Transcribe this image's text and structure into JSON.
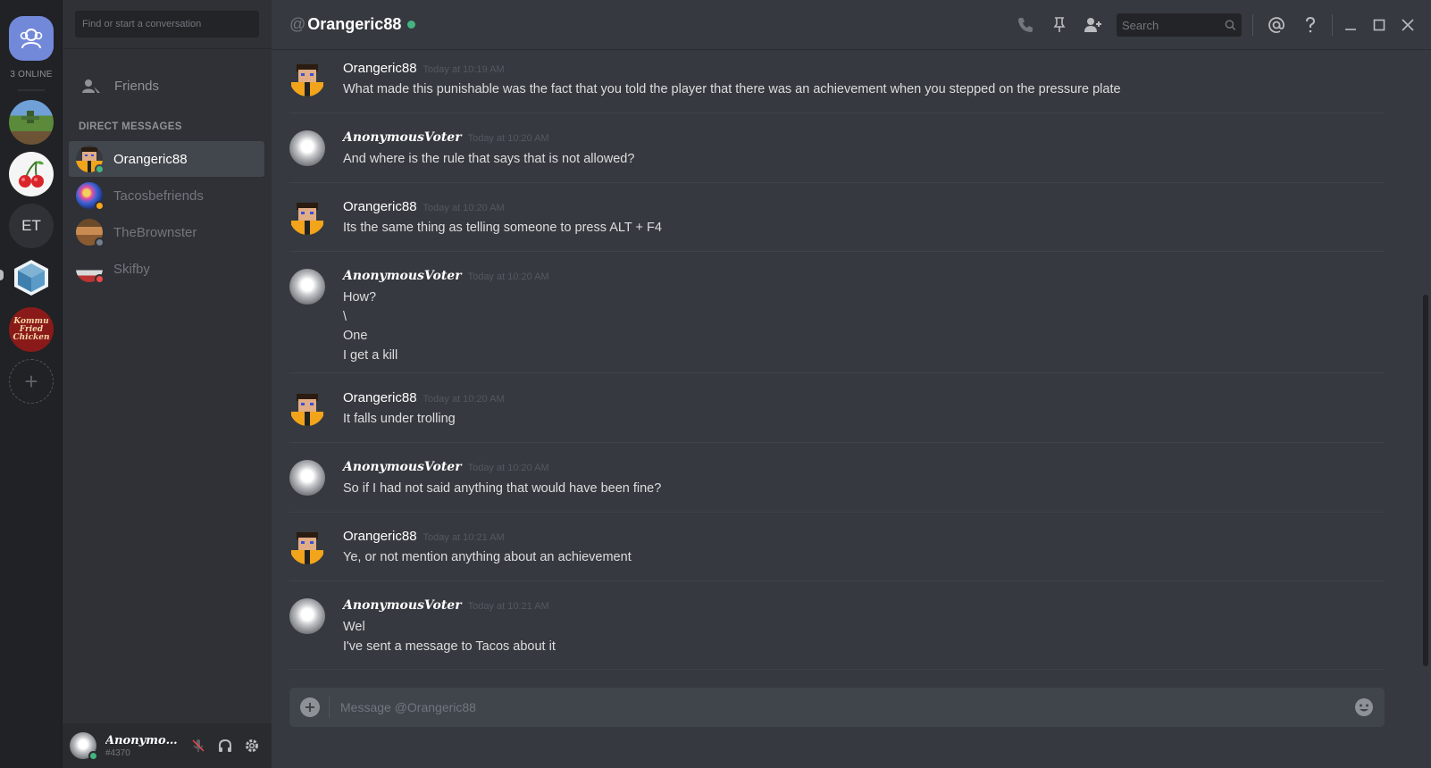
{
  "servers": {
    "online_count": "3 ONLINE",
    "et_label": "ET",
    "kfc_label_line1": "Kommu",
    "kfc_label_line2": "Fried",
    "kfc_label_line3": "Chicken",
    "add_label": "+"
  },
  "sidebar": {
    "search_placeholder": "Find or start a conversation",
    "friends_label": "Friends",
    "dm_header": "DIRECT MESSAGES",
    "dms": [
      {
        "name": "Orangeric88",
        "status_color": "#43b581"
      },
      {
        "name": "Tacosbefriends",
        "status_color": "#faa61a"
      },
      {
        "name": "TheBrownster",
        "status_color": "#747f8d"
      },
      {
        "name": "Skifby",
        "status_color": "#f04747"
      }
    ]
  },
  "user_panel": {
    "name": "Anonymou...",
    "tag": "#4370"
  },
  "header": {
    "at": "@",
    "channel": "Orangeric88",
    "search_placeholder": "Search"
  },
  "messages": [
    {
      "author": "Orangeric88",
      "time": "Today at 10:19 AM",
      "lines": [
        "What made this punishable was the fact that you told the player that there was an achievement when you stepped on the pressure plate"
      ]
    },
    {
      "author": "AnonymousVoter",
      "time": "Today at 10:20 AM",
      "lines": [
        "And where is the rule that says that is not allowed?"
      ]
    },
    {
      "author": "Orangeric88",
      "time": "Today at 10:20 AM",
      "lines": [
        "Its the same thing as telling someone to press ALT + F4"
      ]
    },
    {
      "author": "AnonymousVoter",
      "time": "Today at 10:20 AM",
      "lines": [
        "How?",
        "\\",
        "One",
        "I get a kill"
      ]
    },
    {
      "author": "Orangeric88",
      "time": "Today at 10:20 AM",
      "lines": [
        "It falls under trolling"
      ]
    },
    {
      "author": "AnonymousVoter",
      "time": "Today at 10:20 AM",
      "lines": [
        "So if I had not said anything that would have been fine?"
      ]
    },
    {
      "author": "Orangeric88",
      "time": "Today at 10:21 AM",
      "lines": [
        "Ye, or not mention anything about an achievement"
      ]
    },
    {
      "author": "AnonymousVoter",
      "time": "Today at 10:21 AM",
      "lines": [
        "Wel",
        "I've sent a message to Tacos about it"
      ]
    }
  ],
  "composer": {
    "placeholder": "Message @Orangeric88"
  },
  "colors": {
    "accent": "#7289da",
    "online": "#43b581"
  }
}
